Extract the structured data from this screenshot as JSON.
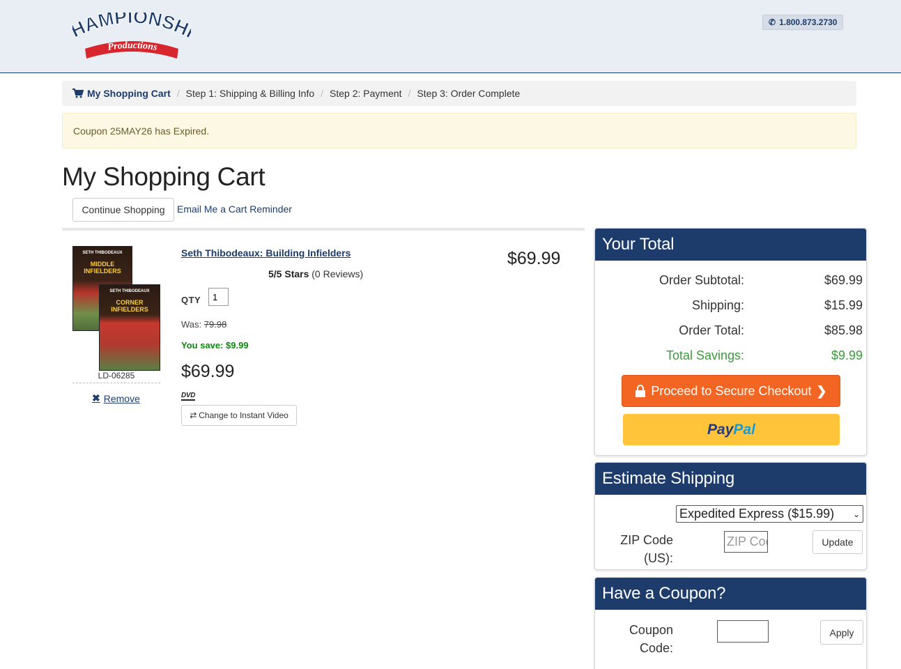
{
  "header": {
    "logo_line1": "CHAMPIONSHIP",
    "logo_line2": "Productions",
    "phone": "1.800.873.2730"
  },
  "breadcrumb": {
    "items": [
      {
        "label": "My Shopping Cart"
      },
      {
        "label": "Step 1: Shipping & Billing Info"
      },
      {
        "label": "Step 2: Payment"
      },
      {
        "label": "Step 3: Order Complete"
      }
    ],
    "separator": "/"
  },
  "alert": {
    "text": "Coupon 25MAY26 has Expired."
  },
  "page": {
    "title": "My Shopping Cart",
    "continue_label": "Continue Shopping",
    "email_reminder_label": "Email Me a Cart Reminder"
  },
  "cart_item": {
    "title": "Seth Thibodeaux: Building Infielders",
    "rating_bold": "5/5 Stars",
    "rating_rest": "(0 Reviews)",
    "qty_label": "QTY",
    "qty": "1",
    "was_label": "Was:",
    "was_price": "79.98",
    "save_text": "You save: $9.99",
    "price": "$69.99",
    "line_total": "$69.99",
    "sku": "LD-06285",
    "remove_label": "Remove",
    "format_label": "DVD",
    "change_label": "Change to Instant Video",
    "box1_top": "SETH THIBODEAUX",
    "box1_main": "MIDDLE INFIELDERS",
    "box2_top": "SETH THIBODEAUX",
    "box2_main": "CORNER INFIELDERS"
  },
  "totals": {
    "heading": "Your Total",
    "rows": [
      {
        "label": "Order Subtotal:",
        "value": "$69.99"
      },
      {
        "label": "Shipping:",
        "value": "$15.99"
      },
      {
        "label": "Order Total:",
        "value": "$85.98"
      },
      {
        "label": "Total Savings:",
        "value": "$9.99"
      }
    ],
    "checkout_label": "Proceed to Secure Checkout",
    "paypal_1": "Pay",
    "paypal_2": "Pal"
  },
  "shipping": {
    "heading": "Estimate Shipping",
    "selected_option": "Expedited Express ($15.99)",
    "zip_label": "ZIP Code (US):",
    "zip_placeholder": "ZIP Code",
    "update_label": "Update"
  },
  "coupon": {
    "heading": "Have a Coupon?",
    "label": "Coupon Code:",
    "apply_label": "Apply"
  },
  "colors": {
    "navy": "#1d3c6b",
    "checkout_orange": "#f26522",
    "paypal_yellow": "#ffc439",
    "savings_green": "#3a9b3a"
  }
}
